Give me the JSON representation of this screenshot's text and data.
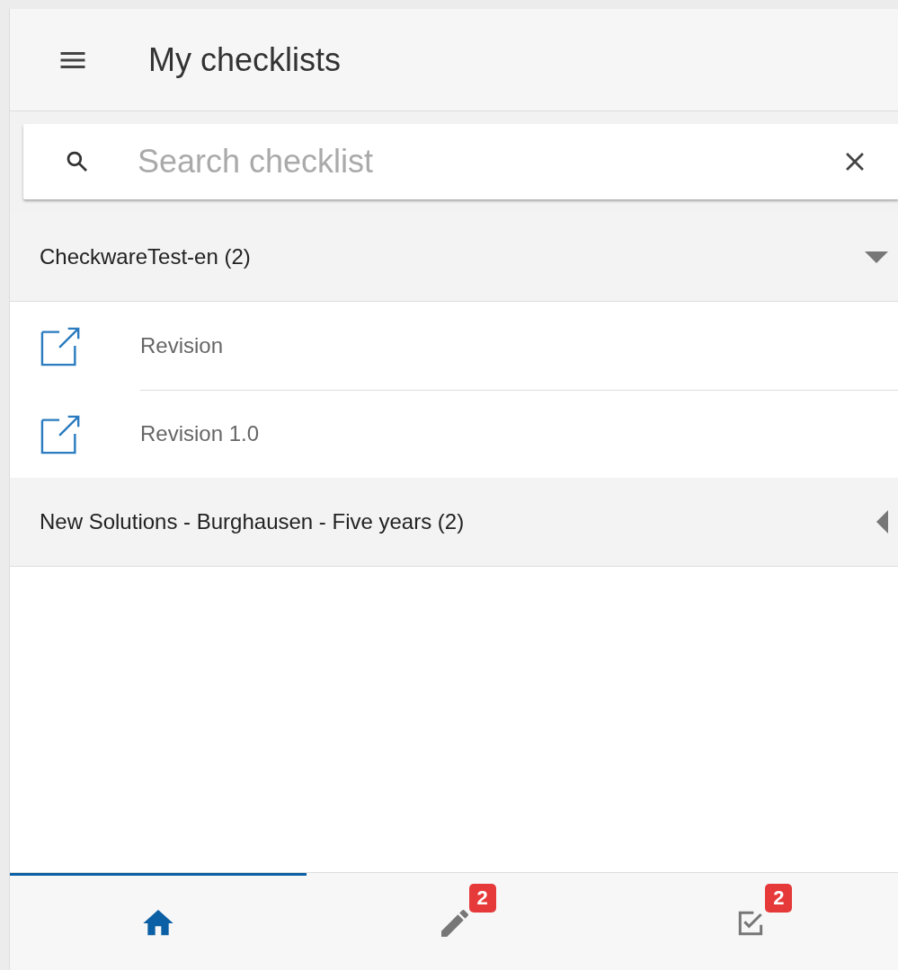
{
  "header": {
    "title": "My checklists"
  },
  "search": {
    "placeholder": "Search checklist"
  },
  "groups": [
    {
      "title": "CheckwareTest-en (2)",
      "expanded": true,
      "items": [
        {
          "label": "Revision"
        },
        {
          "label": "Revision 1.0"
        }
      ]
    },
    {
      "title": "New Solutions - Burghausen - Five years (2)",
      "expanded": false
    }
  ],
  "bottom_nav": [
    {
      "kind": "home",
      "selected": true
    },
    {
      "kind": "pencil",
      "selected": false,
      "badge": "2"
    },
    {
      "kind": "checkbox",
      "selected": false,
      "badge": "2"
    }
  ]
}
